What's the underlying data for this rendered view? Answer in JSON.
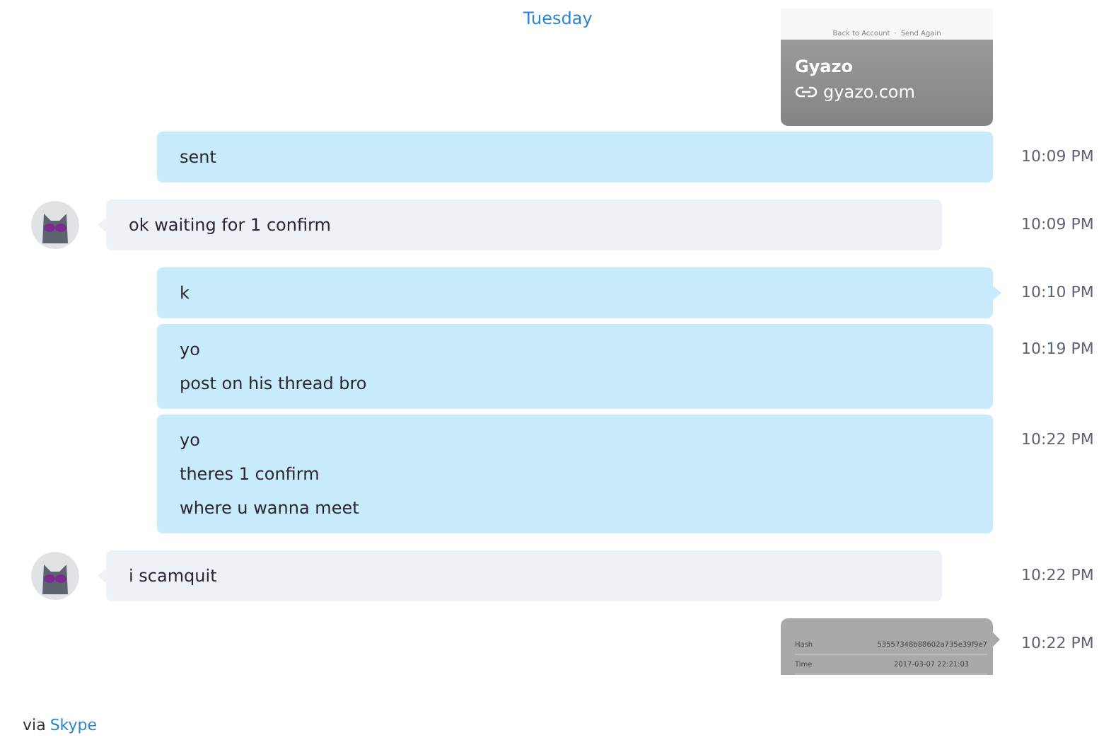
{
  "date_divider": "Tuesday",
  "messages": [
    {
      "kind": "link-preview",
      "incoming": false,
      "image_text": [
        "Back to Account",
        "·",
        "Send Again"
      ],
      "title": "Gyazo",
      "link": "gyazo.com"
    },
    {
      "kind": "text",
      "incoming": false,
      "tail": false,
      "lines": [
        "sent"
      ],
      "time": "10:09 PM"
    },
    {
      "kind": "text",
      "incoming": true,
      "tail": true,
      "lines": [
        "ok waiting for 1 confirm"
      ],
      "time": "10:09 PM"
    },
    {
      "kind": "text",
      "incoming": false,
      "tail": true,
      "lines": [
        "k"
      ],
      "time": "10:10 PM"
    },
    {
      "kind": "text",
      "incoming": false,
      "tail": false,
      "lines": [
        "yo",
        "post on his thread bro"
      ],
      "time": "10:19 PM"
    },
    {
      "kind": "text",
      "incoming": false,
      "tail": false,
      "lines": [
        "yo",
        "theres 1 confirm",
        "where u wanna meet"
      ],
      "time": "10:22 PM"
    },
    {
      "kind": "text",
      "incoming": true,
      "tail": true,
      "lines": [
        "i scamquit"
      ],
      "time": "10:22 PM"
    },
    {
      "kind": "image",
      "incoming": false,
      "tail": true,
      "table": [
        [
          "Hash",
          "53557348b88602a735e39f9e7"
        ],
        [
          "Time",
          "2017-03-07 22:21:03"
        ]
      ],
      "time": "10:22 PM"
    }
  ],
  "footer": {
    "prefix": "via",
    "link": "Skype"
  }
}
